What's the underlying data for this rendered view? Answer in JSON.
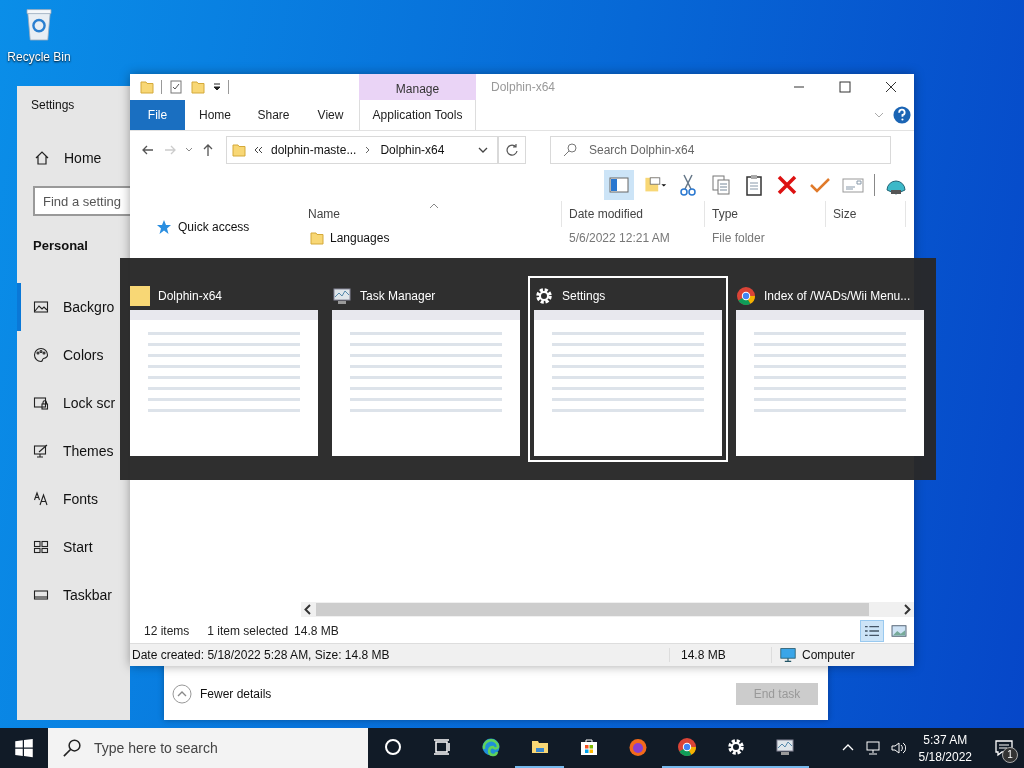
{
  "desktop": {
    "icons": [
      {
        "label": "Recycle Bin"
      }
    ]
  },
  "settings_window": {
    "title": "Settings",
    "home": "Home",
    "search": {
      "placeholder": "Find a setting"
    },
    "section": "Personal",
    "items": [
      {
        "label": "Backgro",
        "kind": "picture",
        "selected": true
      },
      {
        "label": "Colors",
        "kind": "palette",
        "selected": false
      },
      {
        "label": "Lock scr",
        "kind": "lock",
        "selected": false
      },
      {
        "label": "Themes",
        "kind": "themes",
        "selected": false
      },
      {
        "label": "Fonts",
        "kind": "fonts",
        "selected": false
      },
      {
        "label": "Start",
        "kind": "start",
        "selected": false
      },
      {
        "label": "Taskbar",
        "kind": "taskbar",
        "selected": false
      }
    ]
  },
  "task_manager": {
    "fewer_details": "Fewer details",
    "end_task": {
      "label": "End task",
      "disabled": true
    }
  },
  "explorer": {
    "title": "Dolphin-x64",
    "context_header": "Manage",
    "tabs": [
      {
        "label": "File",
        "kind": "file"
      },
      {
        "label": "Home",
        "kind": "tab"
      },
      {
        "label": "Share",
        "kind": "tab"
      },
      {
        "label": "View",
        "kind": "tab"
      },
      {
        "label": "Application Tools",
        "kind": "context"
      }
    ],
    "address": [
      "dolphin-maste...",
      "Dolphin-x64"
    ],
    "search": {
      "placeholder": "Search Dolphin-x64"
    },
    "nav": [
      {
        "label": "Quick access"
      }
    ],
    "columns": [
      "Name",
      "Date modified",
      "Type",
      "Size"
    ],
    "rows": [
      {
        "name": "Languages",
        "date_modified": "5/6/2022 12:21 AM",
        "type": "File folder"
      }
    ],
    "status": {
      "items": "12 items",
      "selected": "1 item selected",
      "selected_size": "14.8 MB"
    },
    "view_buttons": [
      {
        "kind": "details",
        "selected": true
      },
      {
        "kind": "thumbnails",
        "selected": false
      }
    ],
    "details_bar": {
      "text": "Date created: 5/18/2022 5:28 AM, Size: 14.8 MB",
      "size": "14.8 MB",
      "location": "Computer"
    }
  },
  "alt_tab": {
    "items": [
      {
        "title": "Dolphin-x64",
        "kind": "explorer",
        "selected": false
      },
      {
        "title": "Task Manager",
        "kind": "taskmanager",
        "selected": false
      },
      {
        "title": "Settings",
        "kind": "settings",
        "selected": true
      },
      {
        "title": "Index of /WADs/Wii Menu...",
        "kind": "chrome",
        "selected": false
      }
    ]
  },
  "taskbar": {
    "search": {
      "placeholder": "Type here to search"
    },
    "apps": [
      {
        "kind": "cortana",
        "running": false
      },
      {
        "kind": "taskview",
        "running": false
      },
      {
        "kind": "edge",
        "running": false
      },
      {
        "kind": "explorer",
        "running": true
      },
      {
        "kind": "store",
        "running": false
      },
      {
        "kind": "firefox",
        "running": false
      },
      {
        "kind": "chrome",
        "running": true
      },
      {
        "kind": "settings",
        "running": true
      },
      {
        "kind": "taskmanager",
        "running": true
      }
    ],
    "time": "5:37 AM",
    "date": "5/18/2022",
    "notifications": "1"
  }
}
